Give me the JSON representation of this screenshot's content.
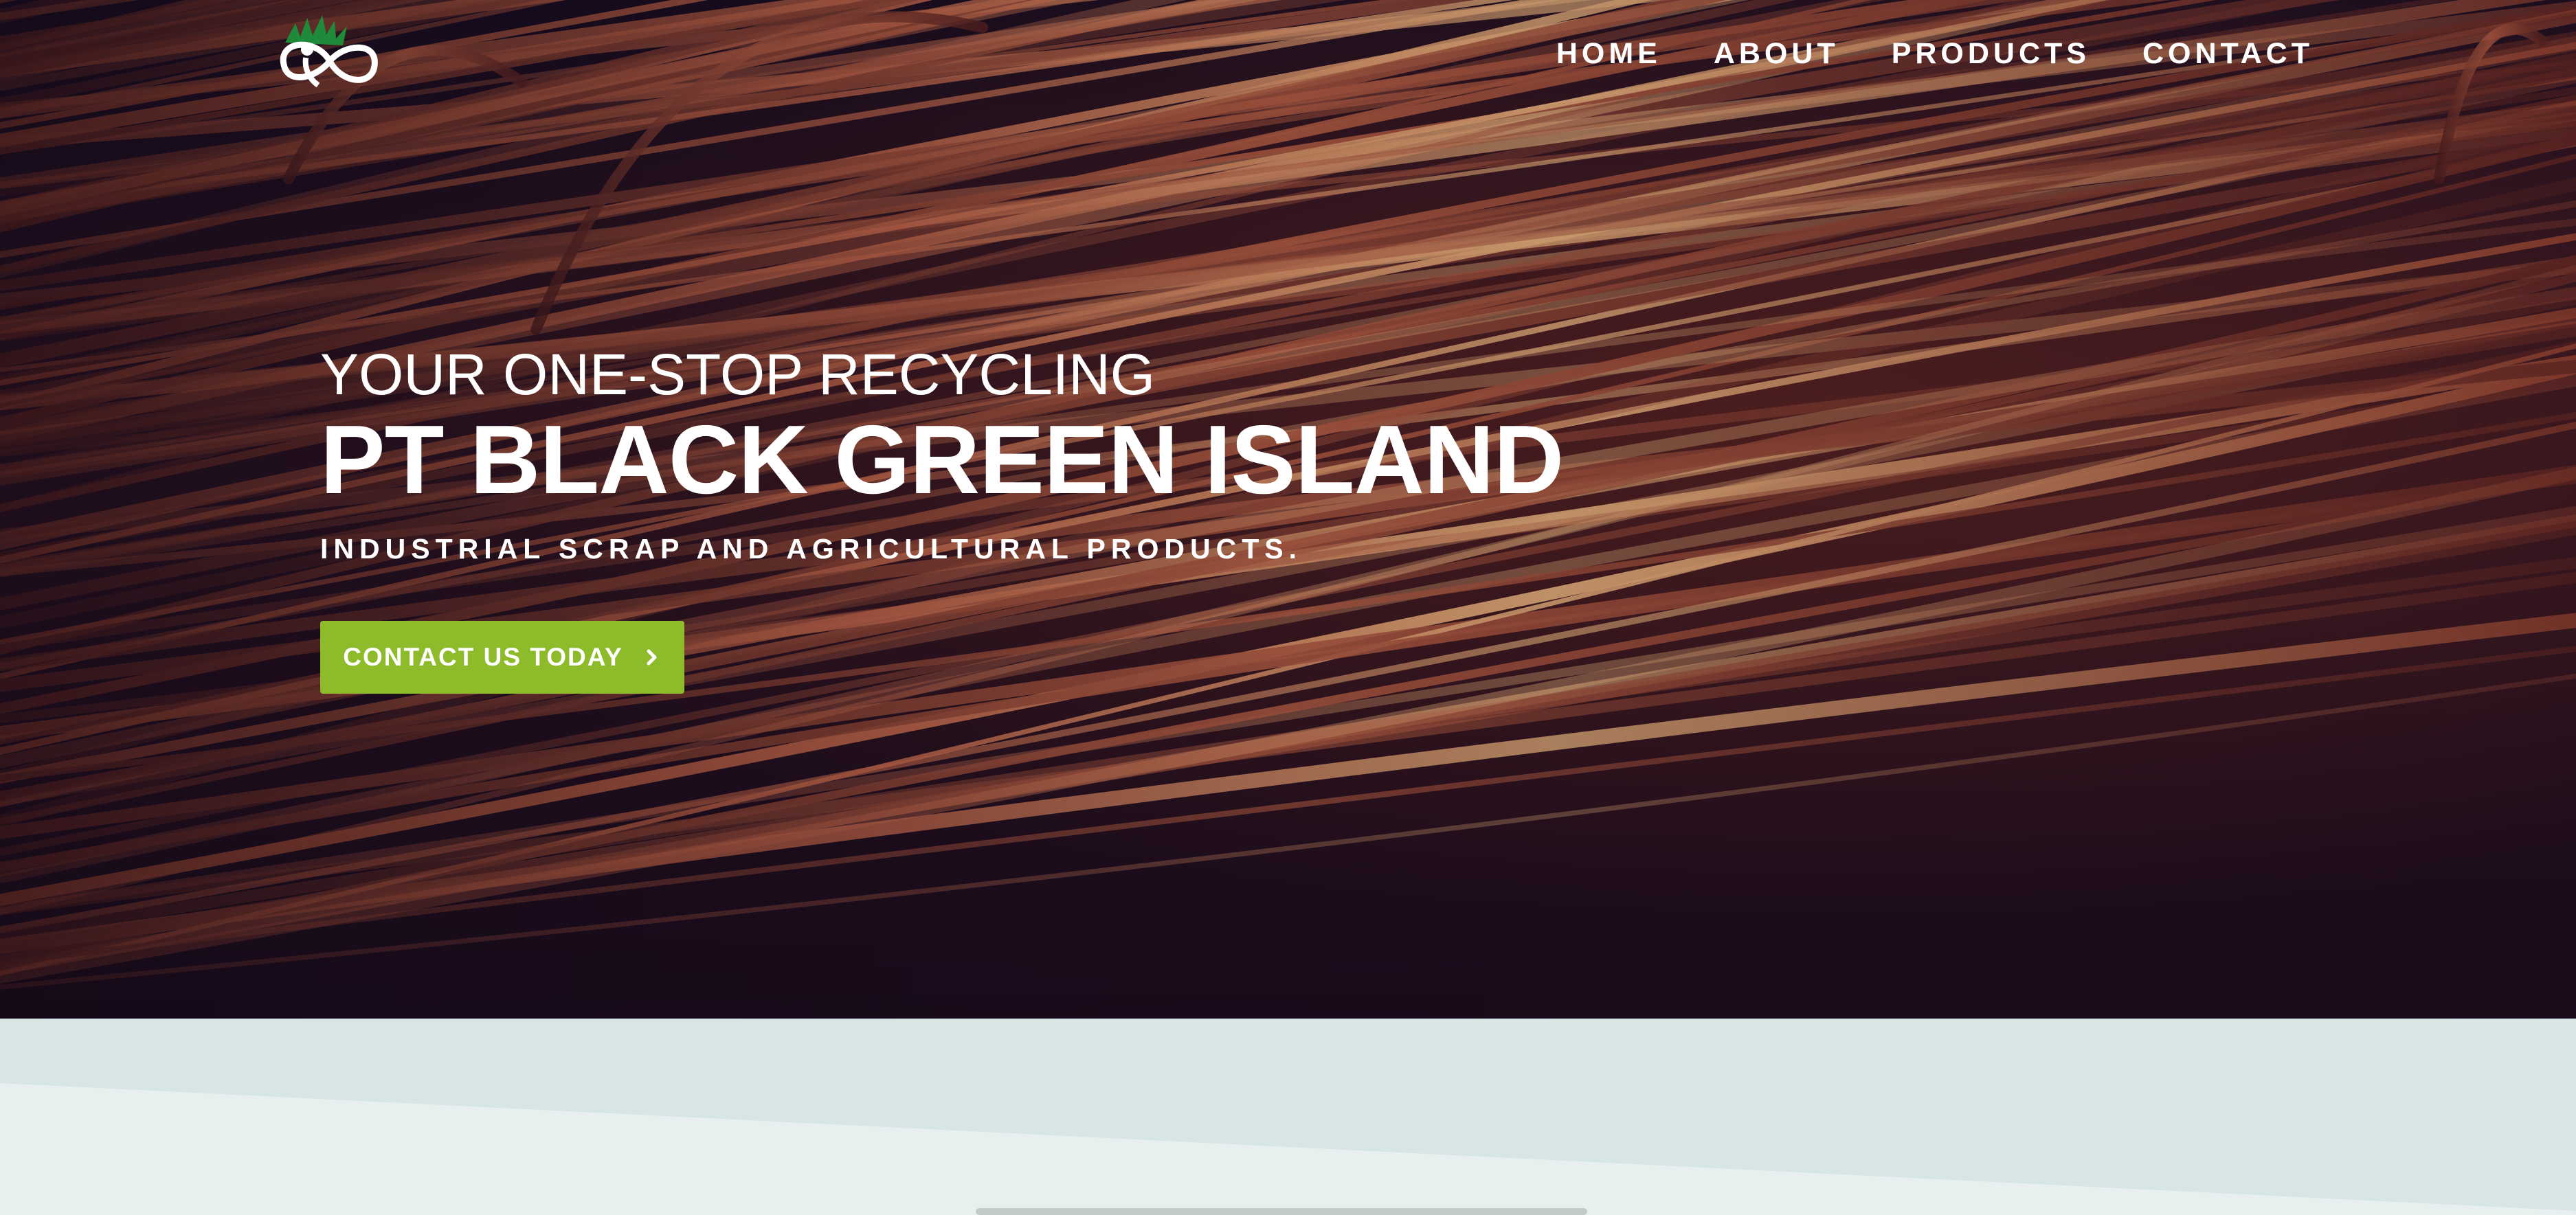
{
  "brand": {
    "logo_icon": "infinity-leaf-logo",
    "colors": {
      "accent": "#8dbb2a",
      "logo_green": "#1f8a3a",
      "band_light": "#e8f0ef",
      "band_dark": "#d7e6e4"
    }
  },
  "nav": {
    "items": [
      {
        "label": "HOME"
      },
      {
        "label": "ABOUT"
      },
      {
        "label": "PRODUCTS"
      },
      {
        "label": "CONTACT"
      }
    ]
  },
  "hero": {
    "tagline": "YOUR ONE-STOP RECYCLING",
    "headline": "PT BLACK GREEN ISLAND",
    "subline": "INDUSTRIAL SCRAP AND AGRICULTURAL PRODUCTS.",
    "cta_label": "CONTACT US TODAY",
    "cta_icon": "chevron-right-icon",
    "background": "copper-wire-photo"
  }
}
